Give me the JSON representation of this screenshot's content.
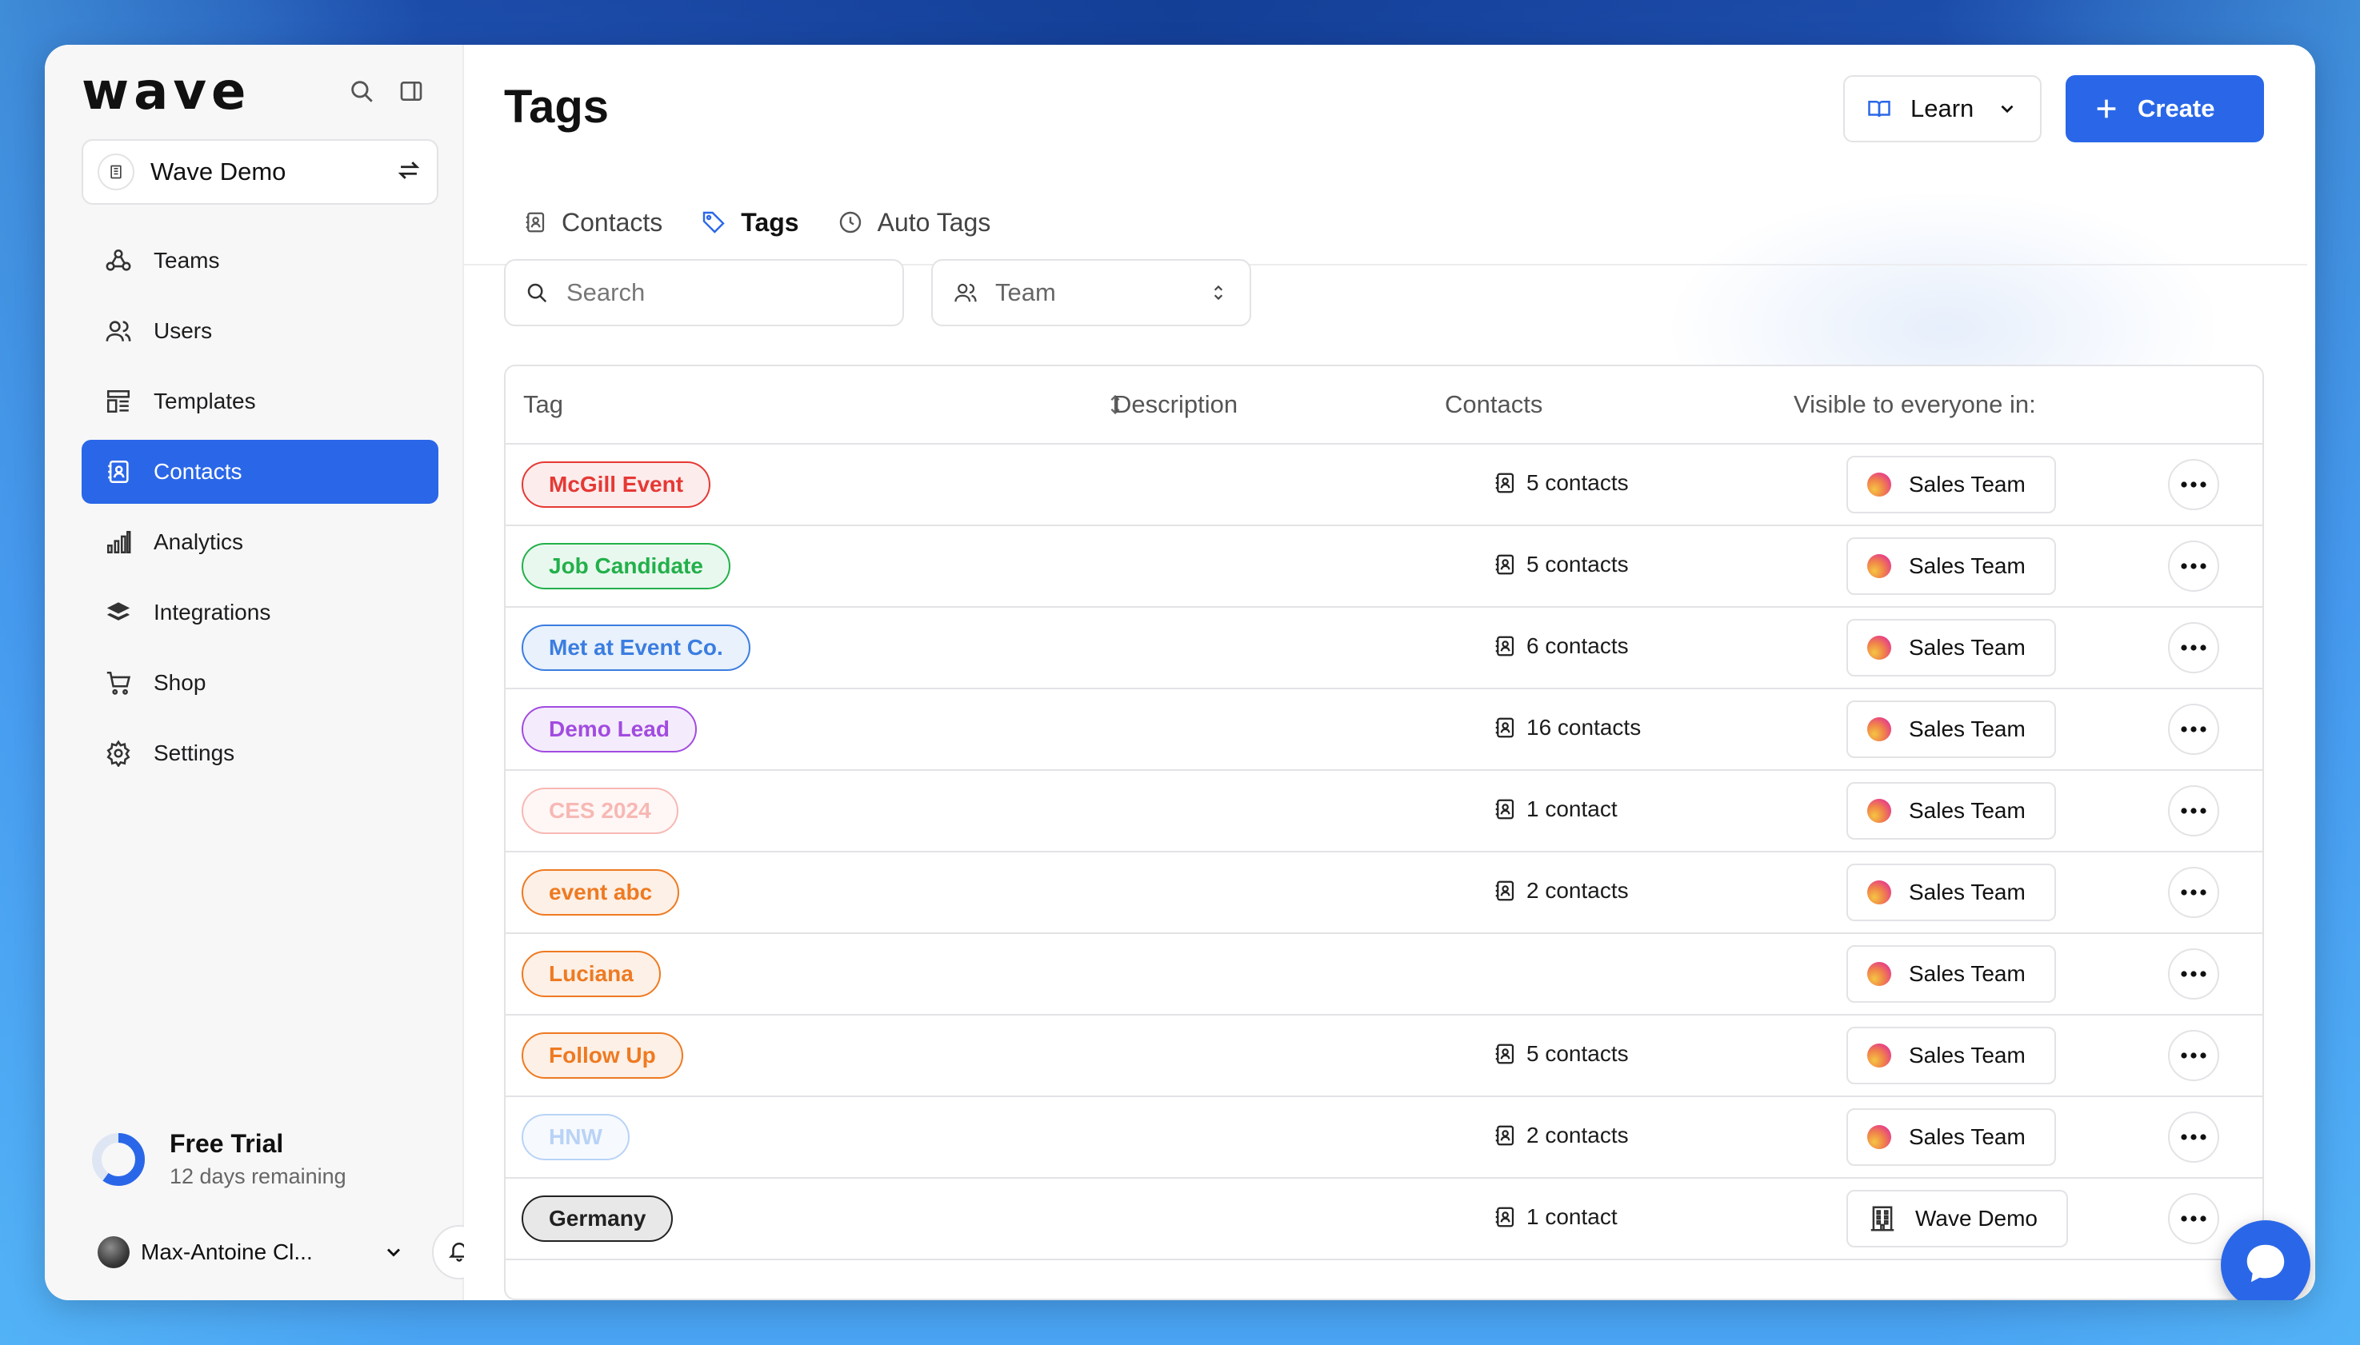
{
  "sidebar": {
    "logo": "wave",
    "workspace": "Wave Demo",
    "nav": [
      {
        "label": "Teams",
        "icon": "teams-icon",
        "active": false
      },
      {
        "label": "Users",
        "icon": "users-icon",
        "active": false
      },
      {
        "label": "Templates",
        "icon": "templates-icon",
        "active": false
      },
      {
        "label": "Contacts",
        "icon": "contacts-icon",
        "active": true
      },
      {
        "label": "Analytics",
        "icon": "analytics-icon",
        "active": false
      },
      {
        "label": "Integrations",
        "icon": "integrations-icon",
        "active": false
      },
      {
        "label": "Shop",
        "icon": "cart-icon",
        "active": false
      },
      {
        "label": "Settings",
        "icon": "gear-icon",
        "active": false
      }
    ],
    "trial": {
      "title": "Free Trial",
      "subtitle": "12 days remaining",
      "progress": 0.6
    },
    "user": {
      "name": "Max-Antoine Cl..."
    }
  },
  "header": {
    "title": "Tags",
    "learn_label": "Learn",
    "create_label": "Create",
    "tabs": [
      {
        "label": "Contacts",
        "icon": "contacts-icon",
        "active": false
      },
      {
        "label": "Tags",
        "icon": "tag-icon",
        "active": true
      },
      {
        "label": "Auto Tags",
        "icon": "clock-icon",
        "active": false
      }
    ]
  },
  "filters": {
    "search_placeholder": "Search",
    "team_placeholder": "Team"
  },
  "table": {
    "columns": [
      "Tag",
      "Description",
      "Contacts",
      "Visible to everyone in:"
    ],
    "rows": [
      {
        "tag": "McGill Event",
        "color": "#e53935",
        "bg": "#fdecec",
        "contacts": "5 contacts",
        "visible": "Sales Team",
        "visible_type": "team"
      },
      {
        "tag": "Job Candidate",
        "color": "#22b04b",
        "bg": "#e9f8ee",
        "contacts": "5 contacts",
        "visible": "Sales Team",
        "visible_type": "team"
      },
      {
        "tag": "Met at Event Co.",
        "color": "#3b7de0",
        "bg": "#e8f1fc",
        "contacts": "6 contacts",
        "visible": "Sales Team",
        "visible_type": "team"
      },
      {
        "tag": "Demo Lead",
        "color": "#a24be0",
        "bg": "#f4ecfc",
        "contacts": "16 contacts",
        "visible": "Sales Team",
        "visible_type": "team"
      },
      {
        "tag": "CES 2024",
        "color": "#f7b8b4",
        "bg": "#fff7f6",
        "contacts": "1 contact",
        "visible": "Sales Team",
        "visible_type": "team"
      },
      {
        "tag": "event abc",
        "color": "#ee7a22",
        "bg": "#fdf0e6",
        "contacts": "2 contacts",
        "visible": "Sales Team",
        "visible_type": "team"
      },
      {
        "tag": "Luciana",
        "color": "#ee7a22",
        "bg": "#fdf0e6",
        "contacts": "",
        "visible": "Sales Team",
        "visible_type": "team"
      },
      {
        "tag": "Follow Up",
        "color": "#ee7a22",
        "bg": "#fdf0e6",
        "contacts": "5 contacts",
        "visible": "Sales Team",
        "visible_type": "team"
      },
      {
        "tag": "HNW",
        "color": "#b9d3f6",
        "bg": "#f6f9fe",
        "contacts": "2 contacts",
        "visible": "Sales Team",
        "visible_type": "team"
      },
      {
        "tag": "Germany",
        "color": "#222222",
        "bg": "#e8e8e8",
        "contacts": "1 contact",
        "visible": "Wave Demo",
        "visible_type": "workspace"
      }
    ]
  },
  "colors": {
    "accent": "#2a67e8"
  }
}
